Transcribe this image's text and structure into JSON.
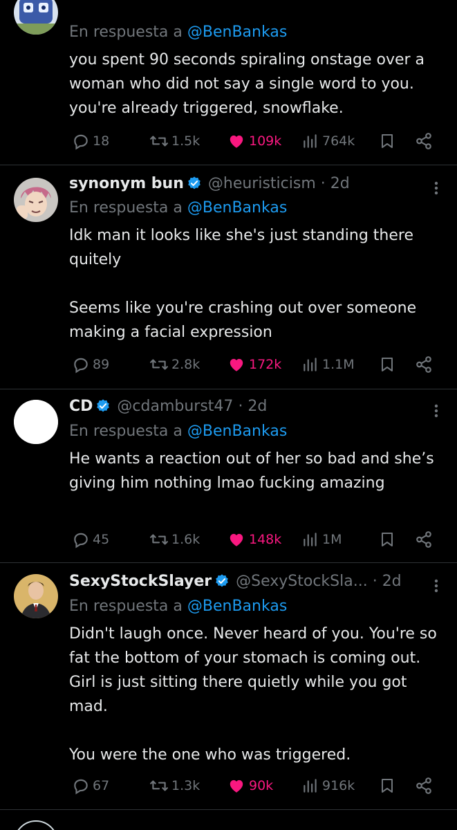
{
  "tweets": [
    {
      "name": "",
      "handle": "",
      "time": "",
      "reply_prefix": "En respuesta a ",
      "reply_mention": "@BenBankas",
      "text": "you spent 90 seconds spiraling onstage over a woman who did not say a single word to you. you're already triggered, snowflake.",
      "replies": "18",
      "reposts": "1.5k",
      "likes": "109k",
      "views": "764k",
      "avatar_icon": "blue-robot-avatar"
    },
    {
      "name": "synonym bun",
      "handle": "@heuristicism",
      "time": "· 2d",
      "reply_prefix": "En respuesta a ",
      "reply_mention": "@BenBankas",
      "text": "Idk man it looks like she's just standing there quitely\n\nSeems like you're crashing out over someone making a facial expression",
      "replies": "89",
      "reposts": "2.8k",
      "likes": "172k",
      "views": "1.1M",
      "avatar_icon": "anime-character-avatar"
    },
    {
      "name": "CD",
      "handle": "@cdamburst47",
      "time": "· 2d",
      "reply_prefix": "En respuesta a ",
      "reply_mention": "@BenBankas",
      "text": "He wants a reaction out of her so bad and she’s giving him nothing lmao fucking amazing",
      "replies": "45",
      "reposts": "1.6k",
      "likes": "148k",
      "views": "1M",
      "avatar_icon": "white-circle-avatar"
    },
    {
      "name": "SexyStockSlayer",
      "handle": "@SexyStockSla...",
      "time": "· 2d",
      "reply_prefix": "En respuesta a ",
      "reply_mention": "@BenBankas",
      "text": "Didn't laugh once. Never heard of you. You're so fat the bottom of your stomach is coming out. Girl is just sitting there quietly while you got mad.\n\nYou were the one who was triggered.",
      "replies": "67",
      "reposts": "1.3k",
      "likes": "90k",
      "views": "916k",
      "avatar_icon": "man-in-suit-avatar"
    }
  ],
  "colors": {
    "background": "#000000",
    "text": "#e7e9ea",
    "secondary": "#71767b",
    "link": "#1d9bf0",
    "like": "#f91880",
    "divider": "#2f3336",
    "verified": "#1d9bf0"
  }
}
